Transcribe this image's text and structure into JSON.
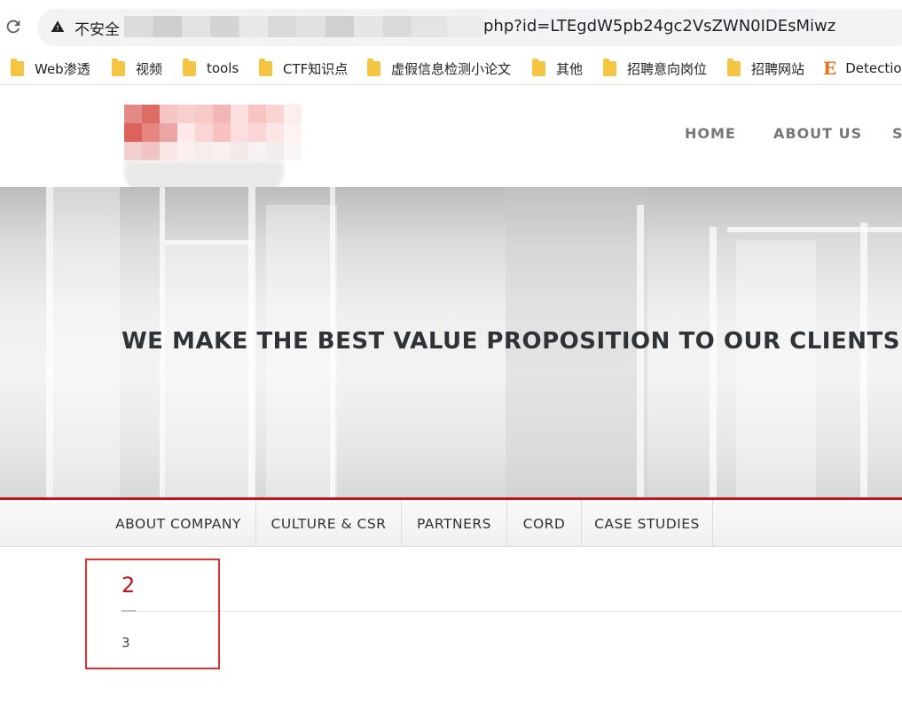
{
  "browser": {
    "security_label": "不安全",
    "url_visible": "php?id=LTEgdW5pb24gc2VsZWN0IDEsMiwz"
  },
  "bookmarks": [
    {
      "label": "Web渗透",
      "icon": "folder-icon"
    },
    {
      "label": "视频",
      "icon": "folder-icon"
    },
    {
      "label": "tools",
      "icon": "folder-icon"
    },
    {
      "label": "CTF知识点",
      "icon": "folder-icon"
    },
    {
      "label": "虚假信息检测小论文",
      "icon": "folder-icon"
    },
    {
      "label": "其他",
      "icon": "folder-icon"
    },
    {
      "label": "招聘意向岗位",
      "icon": "folder-icon"
    },
    {
      "label": "招聘网站",
      "icon": "folder-icon"
    },
    {
      "label": "Detectio",
      "icon": "e-icon"
    }
  ],
  "site": {
    "nav": [
      "HOME",
      "ABOUT US",
      "S"
    ],
    "hero_title": "WE MAKE THE BEST VALUE PROPOSITION TO OUR CLIENTS",
    "subnav": [
      "ABOUT COMPANY",
      "CULTURE & CSR",
      "PARTNERS",
      "CORD",
      "CASE STUDIES"
    ],
    "content": {
      "heading": "2",
      "body": "3"
    }
  },
  "colors": {
    "accent_red": "#c0141c",
    "highlight_box": "#e03131"
  }
}
